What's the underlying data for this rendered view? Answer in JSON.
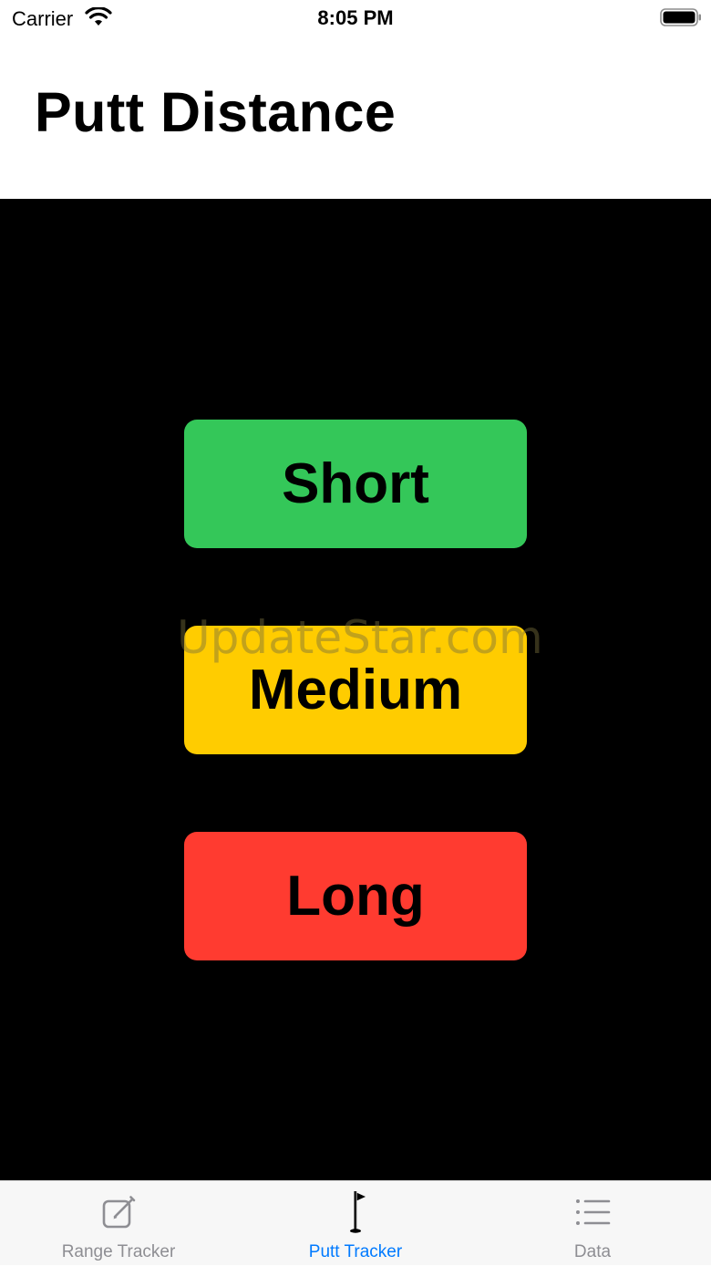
{
  "status_bar": {
    "carrier": "Carrier",
    "time": "8:05 PM",
    "wifi_icon": "wifi-icon",
    "battery_icon": "battery-icon"
  },
  "header": {
    "title": "Putt Distance"
  },
  "buttons": [
    {
      "label": "Short",
      "color": "#34c759"
    },
    {
      "label": "Medium",
      "color": "#ffcc00"
    },
    {
      "label": "Long",
      "color": "#ff3b30"
    }
  ],
  "watermark": "UpdateStar.com",
  "tab_bar": {
    "active_color": "#007aff",
    "inactive_color": "#8e8e93",
    "tabs": [
      {
        "label": "Range Tracker",
        "icon": "compose-icon",
        "active": false
      },
      {
        "label": "Putt Tracker",
        "icon": "golf-flag-icon",
        "active": true
      },
      {
        "label": "Data",
        "icon": "list-icon",
        "active": false
      }
    ]
  }
}
